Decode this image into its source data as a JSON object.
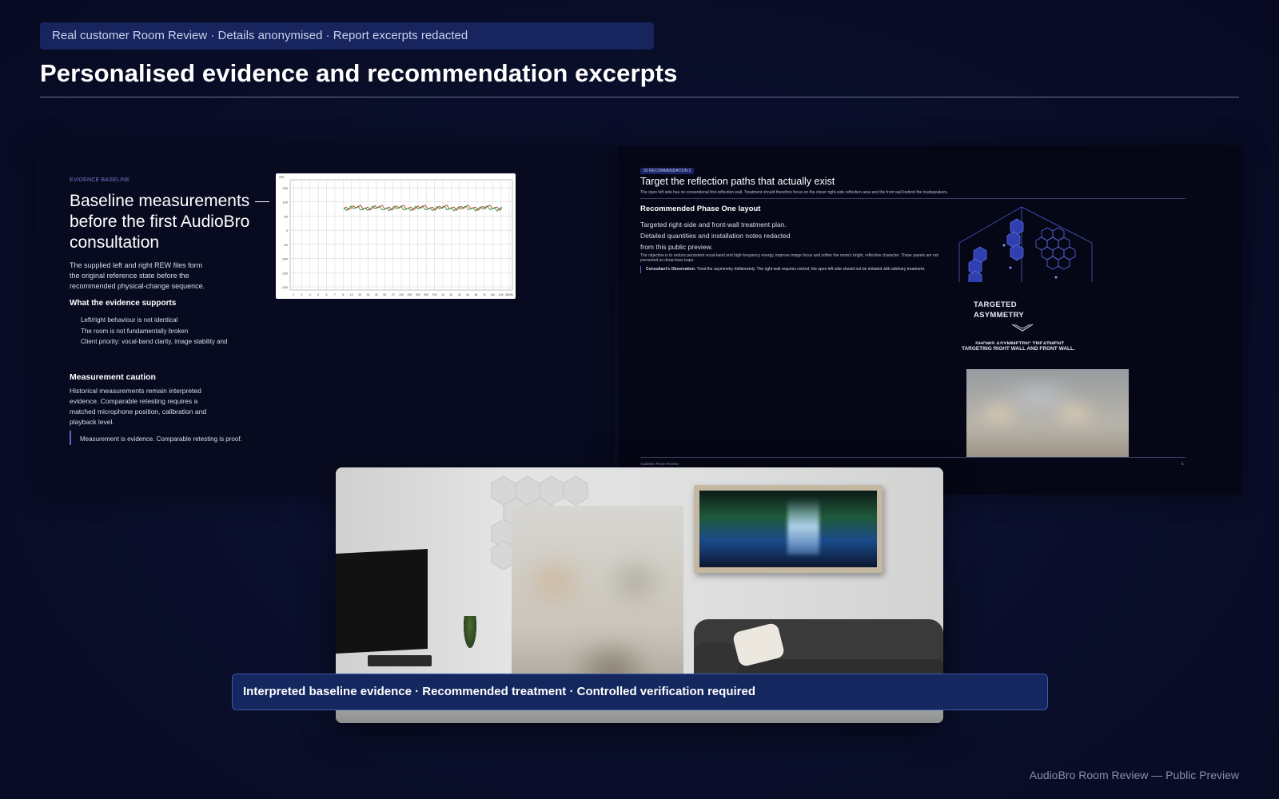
{
  "top_banner": "Real customer Room Review · Details anonymised · Report excerpts redacted",
  "page_title": "Personalised evidence and recommendation excerpts",
  "evidence_slide": {
    "kicker": "EVIDENCE BASELINE",
    "heading": "Baseline measurements before the first AudioBro consultation",
    "intro": "The supplied left and right REW files form the original reference state before the recommended physical-change sequence.",
    "supports_heading": "What the evidence supports",
    "supports_items": [
      "Left/right behaviour is not identical",
      "The room is not fundamentally broken",
      "Client priority: vocal-band clarity, image stability and"
    ],
    "caution_heading": "Measurement caution",
    "caution_text": "Historical measurements remain interpreted evidence. Comparable retesting requires a matched microphone position, calibration and playback level.",
    "quote": "Measurement is evidence. Comparable retesting is proof.",
    "chart": {
      "y_label": "SPL",
      "y_ticks": [
        "150",
        "100",
        "50",
        "0",
        "-50",
        "-100",
        "-150",
        "-200"
      ],
      "x_ticks": [
        "2",
        "3",
        "4",
        "5",
        "6",
        "7",
        "8",
        "10",
        "20",
        "30",
        "40",
        "50",
        "70",
        "100",
        "200",
        "300",
        "500",
        "700",
        "1k",
        "2k",
        "3k",
        "4k",
        "5k",
        "7k",
        "10k",
        "20k",
        "30kHz"
      ],
      "series_colors": [
        "#c0392b",
        "#2e8b3a"
      ]
    }
  },
  "recommendation_slide": {
    "badge": "02 RECOMMENDATION 2",
    "title": "Target the reflection paths that actually exist",
    "description": "The open left side has no conventional first-reflection wall. Treatment should therefore focus on the closer right-side reflection area and the front wall behind the loudspeakers.",
    "phase_heading": "Recommended Phase One layout",
    "phase_lines": [
      "Targeted right-side and front-wall treatment plan.",
      "Detailed quantities and installation notes redacted",
      "from this public preview."
    ],
    "objective": "The objective is to reduce persistent vocal-band and high-frequency energy, improve image focus and soften the room's bright, reflective character. These panels are not presented as deep-bass traps.",
    "observation_label": "Consultant's Observation:",
    "observation_text": "Treat the asymmetry deliberately. The right wall requires control; the open left side should not be imitated with arbitrary treatment.",
    "asym_label": "TARGETED ASYMMETRY",
    "asym_caption_1": "SHOWS ASYMMETRIC TREATMENT",
    "asym_caption_2": "TARGETING RIGHT WALL AND FRONT WALL.",
    "footer_left": "AudioBro Room Review",
    "footer_right": "5"
  },
  "bottom_banner": "Interpreted baseline evidence · Recommended treatment · Controlled verification required",
  "footer_credit": "AudioBro Room Review — Public Preview"
}
